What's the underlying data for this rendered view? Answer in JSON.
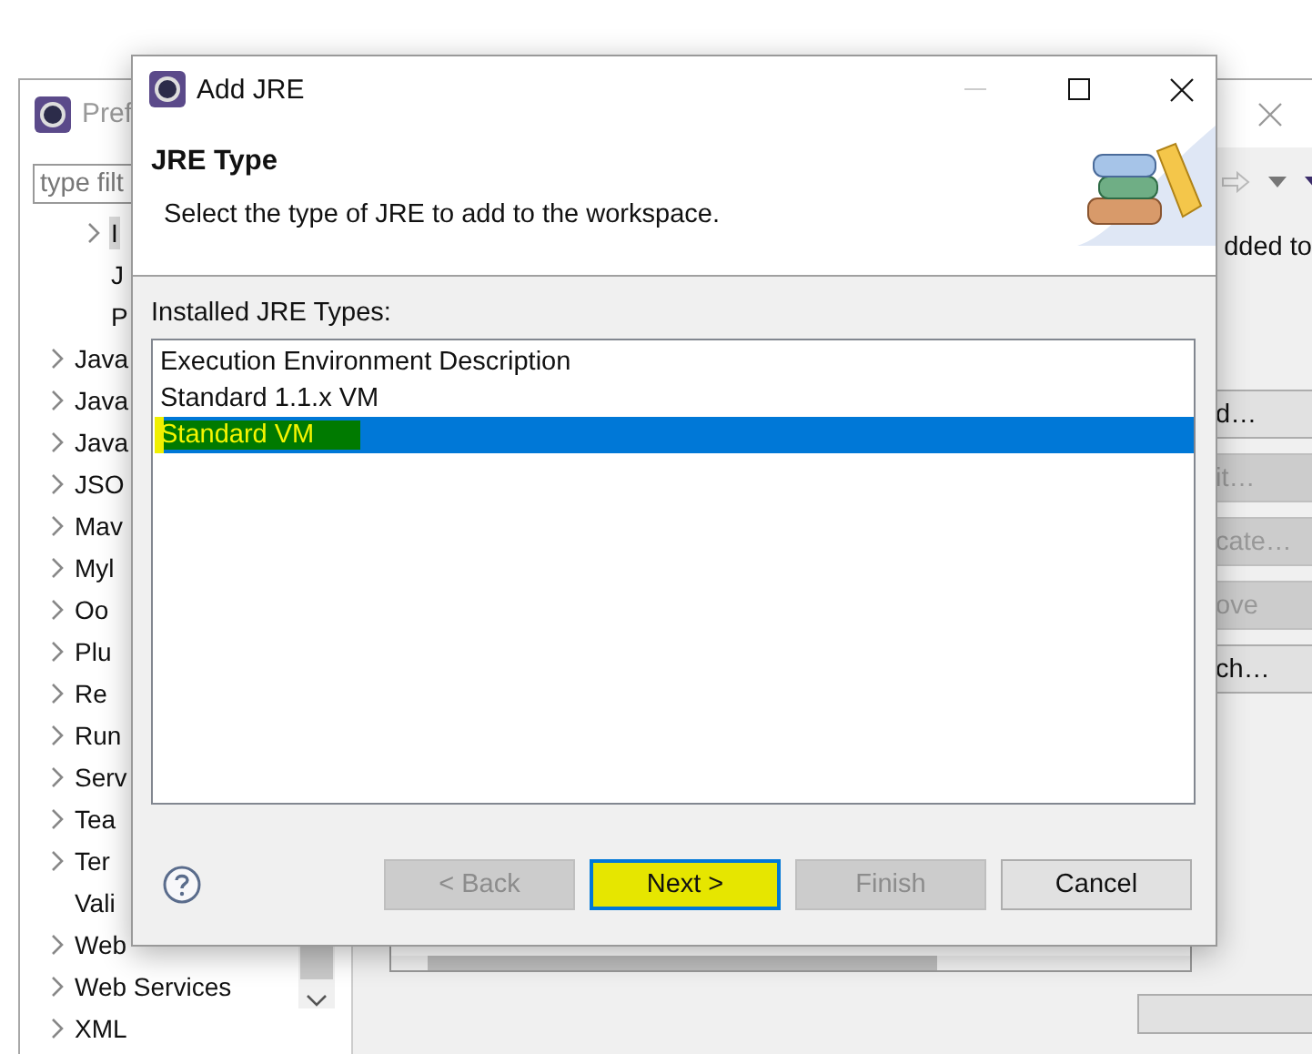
{
  "background_window": {
    "title": "Pref",
    "filter": {
      "placeholder": "type filt"
    },
    "tree": {
      "nested_items": [
        {
          "label": "I",
          "expandable": true,
          "selected": true
        },
        {
          "label": "J",
          "expandable": false,
          "selected": false
        },
        {
          "label": "P",
          "expandable": false,
          "selected": false
        }
      ],
      "items": [
        {
          "label": "Java",
          "expandable": true,
          "selected": false
        },
        {
          "label": "Java",
          "expandable": true,
          "selected": false
        },
        {
          "label": "Java",
          "expandable": true,
          "selected": false
        },
        {
          "label": "JSO",
          "expandable": true,
          "selected": false
        },
        {
          "label": "Mav",
          "expandable": true,
          "selected": false
        },
        {
          "label": "Myl",
          "expandable": true,
          "selected": false
        },
        {
          "label": "Oo",
          "expandable": true,
          "selected": false
        },
        {
          "label": "Plu",
          "expandable": true,
          "selected": false
        },
        {
          "label": "Re",
          "expandable": true,
          "selected": false
        },
        {
          "label": "Run",
          "expandable": true,
          "selected": false
        },
        {
          "label": "Serv",
          "expandable": true,
          "selected": false
        },
        {
          "label": "Tea",
          "expandable": true,
          "selected": false
        },
        {
          "label": "Ter",
          "expandable": true,
          "selected": false
        },
        {
          "label": "Vali",
          "expandable": false,
          "selected": false
        },
        {
          "label": "Web",
          "expandable": true,
          "selected": false
        },
        {
          "label": "Web Services",
          "expandable": true,
          "selected": false
        },
        {
          "label": "XML",
          "expandable": true,
          "selected": false
        }
      ]
    },
    "pane_text": "dded to",
    "buttons": [
      {
        "label": "d…",
        "disabled": false
      },
      {
        "label": "it…",
        "disabled": true
      },
      {
        "label": "cate…",
        "disabled": true
      },
      {
        "label": "ove",
        "disabled": true
      },
      {
        "label": "ch…",
        "disabled": false
      }
    ]
  },
  "dialog": {
    "title": "Add JRE",
    "heading": "JRE Type",
    "description": "Select the type of JRE to add to the workspace.",
    "list_label": "Installed JRE Types:",
    "jre_types": [
      {
        "label": "Execution Environment Description",
        "selected": false,
        "highlighted": false
      },
      {
        "label": "Standard 1.1.x VM",
        "selected": false,
        "highlighted": false
      },
      {
        "label": "Standard VM",
        "selected": true,
        "highlighted": true
      }
    ],
    "buttons": [
      {
        "label": "< Back",
        "disabled": true,
        "default": false,
        "highlighted": false
      },
      {
        "label": "Next >",
        "disabled": false,
        "default": true,
        "highlighted": true
      },
      {
        "label": "Finish",
        "disabled": true,
        "default": false,
        "highlighted": false
      },
      {
        "label": "Cancel",
        "disabled": false,
        "default": false,
        "highlighted": false
      }
    ]
  }
}
